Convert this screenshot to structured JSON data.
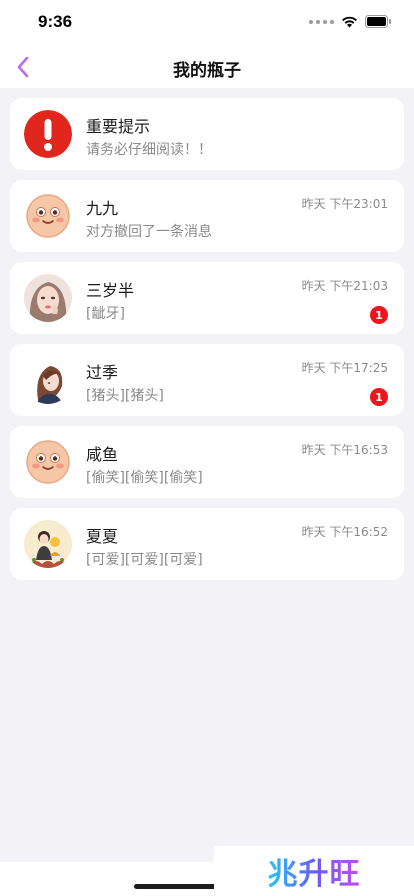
{
  "status_bar": {
    "time": "9:36"
  },
  "nav": {
    "title": "我的瓶子",
    "back_icon": "chevron-left-icon",
    "accent_color": "#b86cf5"
  },
  "notice": {
    "title": "重要提示",
    "subtitle": "请务必仔细阅读！！",
    "icon": "exclamation-circle-icon",
    "icon_color": "#e0261d"
  },
  "conversations": [
    {
      "name": "九九",
      "preview": "对方撤回了一条消息",
      "time": "昨天 下午23:01",
      "badge": null,
      "avatar": "smiley-face-avatar"
    },
    {
      "name": "三岁半",
      "preview": "[龇牙]",
      "time": "昨天 下午21:03",
      "badge": "1",
      "avatar": "girl-photo-avatar"
    },
    {
      "name": "过季",
      "preview": "[猪头][猪头]",
      "time": "昨天 下午17:25",
      "badge": "1",
      "avatar": "anime-girl-avatar"
    },
    {
      "name": "咸鱼",
      "preview": "[偷笑][偷笑][偷笑]",
      "time": "昨天 下午16:53",
      "badge": null,
      "avatar": "smiley-face-avatar"
    },
    {
      "name": "夏夏",
      "preview": "[可爱][可爱][可爱]",
      "time": "昨天 下午16:52",
      "badge": null,
      "avatar": "illustration-avatar"
    }
  ],
  "watermark": {
    "text": "兆升旺"
  }
}
